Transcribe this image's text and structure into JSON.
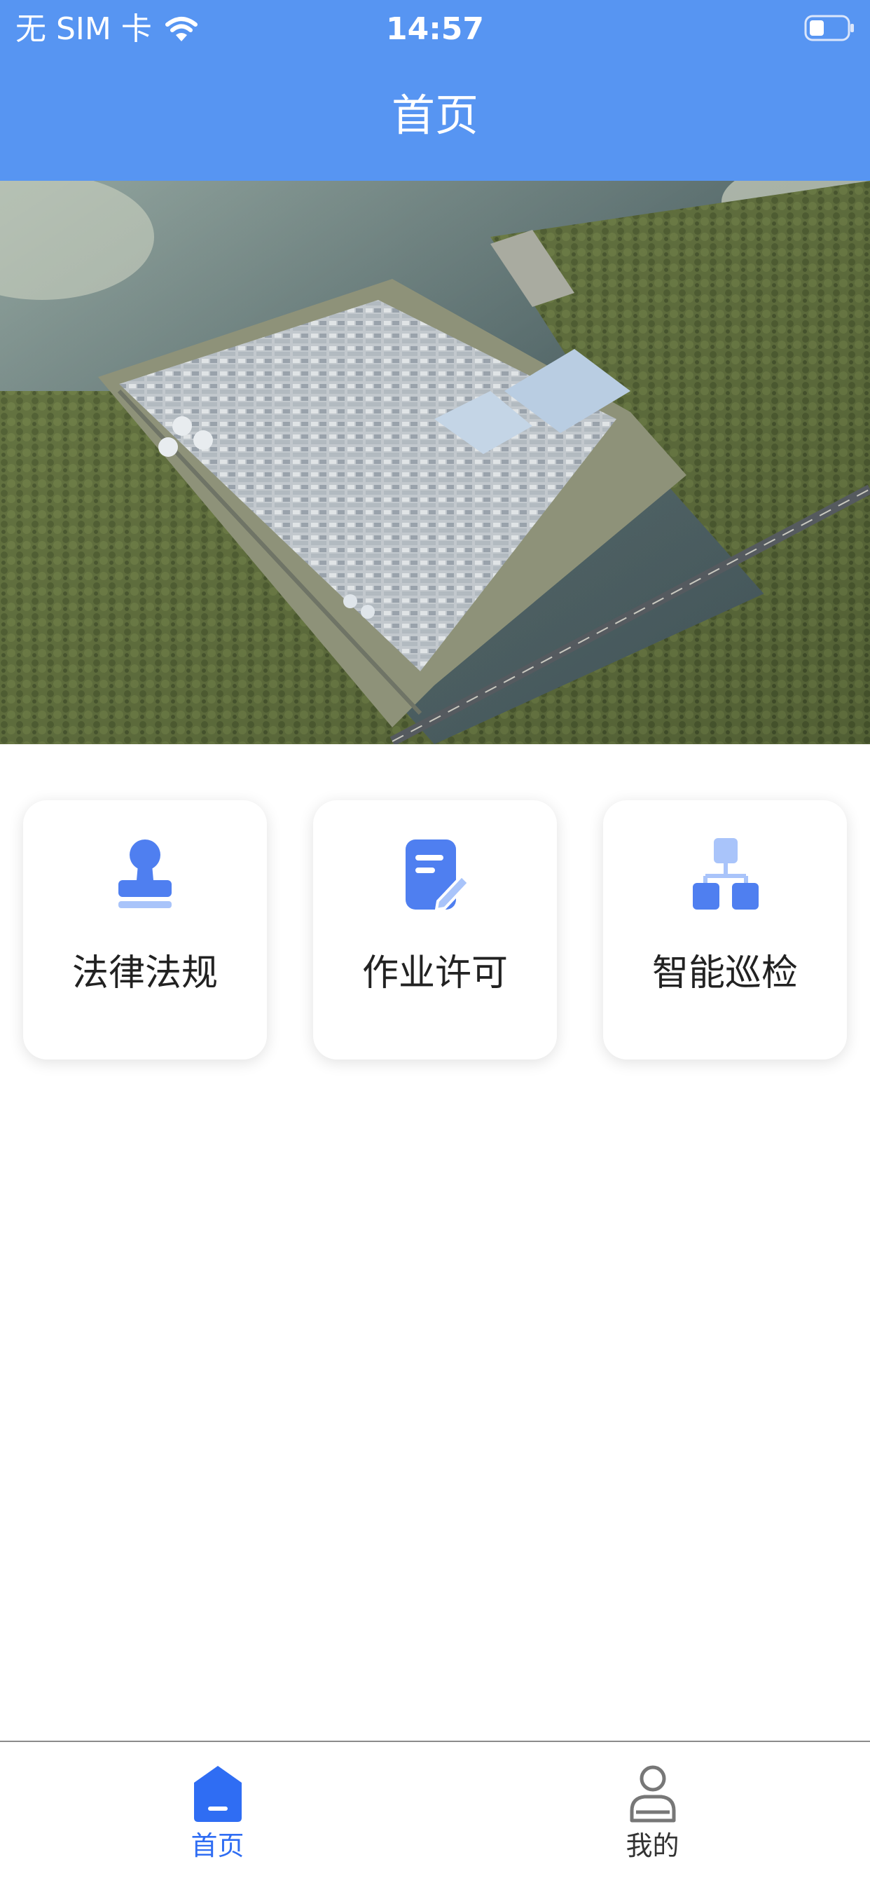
{
  "status_bar": {
    "carrier": "无 SIM 卡",
    "time": "14:57"
  },
  "header": {
    "title": "首页"
  },
  "banner": {
    "image": "industrial-park-aerial-photo"
  },
  "features": [
    {
      "label": "法律法规",
      "icon": "stamp-icon"
    },
    {
      "label": "作业许可",
      "icon": "document-edit-icon"
    },
    {
      "label": "智能巡检",
      "icon": "hierarchy-icon"
    }
  ],
  "tab_bar": {
    "items": [
      {
        "label": "首页",
        "icon": "home-icon",
        "active": true
      },
      {
        "label": "我的",
        "icon": "profile-icon",
        "active": false
      }
    ]
  },
  "colors": {
    "primary": "#5795f2",
    "accent": "#2f6df3",
    "icon_blue": "#4f7ff0",
    "icon_light": "#a9c4fa"
  }
}
